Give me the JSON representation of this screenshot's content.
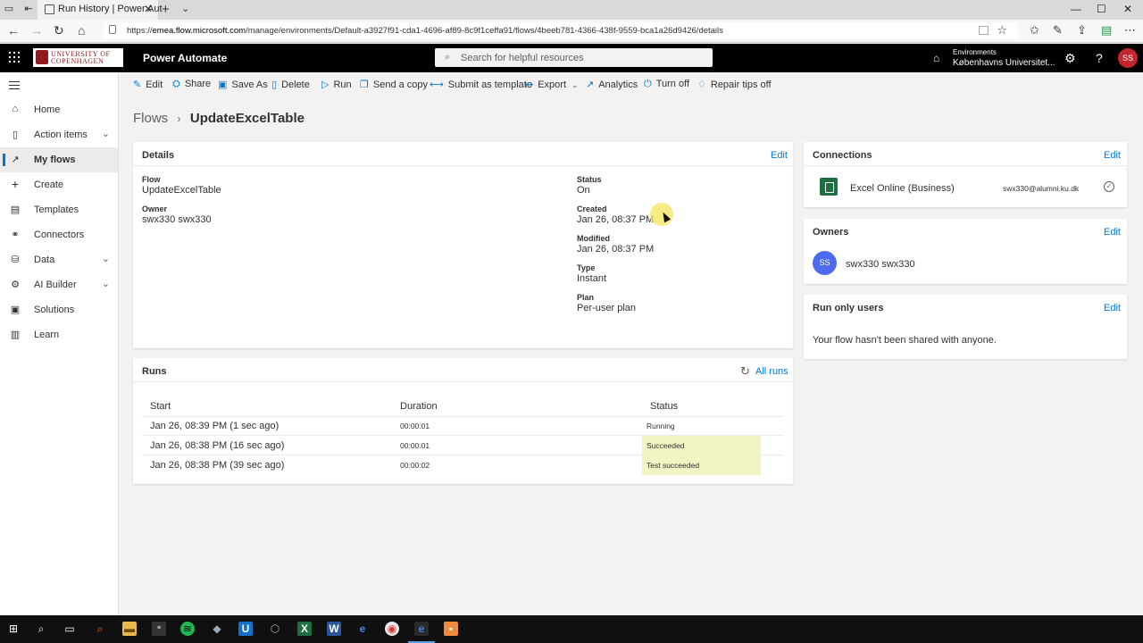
{
  "browser": {
    "tab_title": "Run History | Power Aut",
    "url_prefix": "https://",
    "url_host": "emea.flow.microsoft.com",
    "url_path": "/manage/environments/Default-a3927f91-cda1-4696-af89-8c9f1ceffa91/flows/4beeb781-4366-438f-9559-bca1a26d9426/details",
    "new_tab_label": "+",
    "close_tab_label": "✕"
  },
  "header": {
    "logo_line1": "UNIVERSITY OF",
    "logo_line2": "COPENHAGEN",
    "app_name": "Power Automate",
    "search_placeholder": "Search for helpful resources",
    "env_label": "Environments",
    "env_name": "Københavns Universitet...",
    "avatar": "SS",
    "help": "?"
  },
  "nav": {
    "items": [
      {
        "label": "Home",
        "icon": "home-icon"
      },
      {
        "label": "Action items",
        "icon": "clipboard-icon"
      },
      {
        "label": "My flows",
        "icon": "flow-icon"
      },
      {
        "label": "Create",
        "icon": "plus-icon"
      },
      {
        "label": "Templates",
        "icon": "templates-icon"
      },
      {
        "label": "Connectors",
        "icon": "connector-icon"
      },
      {
        "label": "Data",
        "icon": "database-icon"
      },
      {
        "label": "AI Builder",
        "icon": "ai-builder-icon"
      },
      {
        "label": "Solutions",
        "icon": "solutions-icon"
      },
      {
        "label": "Learn",
        "icon": "book-icon"
      }
    ]
  },
  "commands": {
    "edit": "Edit",
    "share": "Share",
    "save_as": "Save As",
    "delete": "Delete",
    "run": "Run",
    "send_copy": "Send a copy",
    "submit_template": "Submit as template",
    "export": "Export",
    "analytics": "Analytics",
    "turn_off": "Turn off",
    "repair_tips": "Repair tips off"
  },
  "breadcrumb": {
    "parent": "Flows",
    "current": "UpdateExcelTable"
  },
  "details": {
    "title": "Details",
    "edit": "Edit",
    "flow_label": "Flow",
    "flow_value": "UpdateExcelTable",
    "owner_label": "Owner",
    "owner_value": "swx330 swx330",
    "status_label": "Status",
    "status_value": "On",
    "created_label": "Created",
    "created_value": "Jan 26, 08:37 PM",
    "modified_label": "Modified",
    "modified_value": "Jan 26, 08:37 PM",
    "type_label": "Type",
    "type_value": "Instant",
    "plan_label": "Plan",
    "plan_value": "Per-user plan"
  },
  "connections": {
    "title": "Connections",
    "edit": "Edit",
    "name": "Excel Online (Business)",
    "account": "swx330@alumni.ku.dk"
  },
  "owners": {
    "title": "Owners",
    "edit": "Edit",
    "initials": "SS",
    "name": "swx330 swx330"
  },
  "run_only": {
    "title": "Run only users",
    "edit": "Edit",
    "message": "Your flow hasn't been shared with anyone."
  },
  "runs": {
    "title": "Runs",
    "all_runs": "All runs",
    "col_start": "Start",
    "col_duration": "Duration",
    "col_status": "Status",
    "rows": [
      {
        "start": "Jan 26, 08:39 PM (1 sec ago)",
        "duration": "00:00:01",
        "status": "Running"
      },
      {
        "start": "Jan 26, 08:38 PM (16 sec ago)",
        "duration": "00:00:01",
        "status": "Succeeded"
      },
      {
        "start": "Jan 26, 08:38 PM (39 sec ago)",
        "duration": "00:00:02",
        "status": "Test succeeded"
      }
    ]
  },
  "colors": {
    "accent": "#0078d4",
    "header_bg": "#000000",
    "status_highlight": "#f2f4c4",
    "brand_red": "#901a1e"
  }
}
